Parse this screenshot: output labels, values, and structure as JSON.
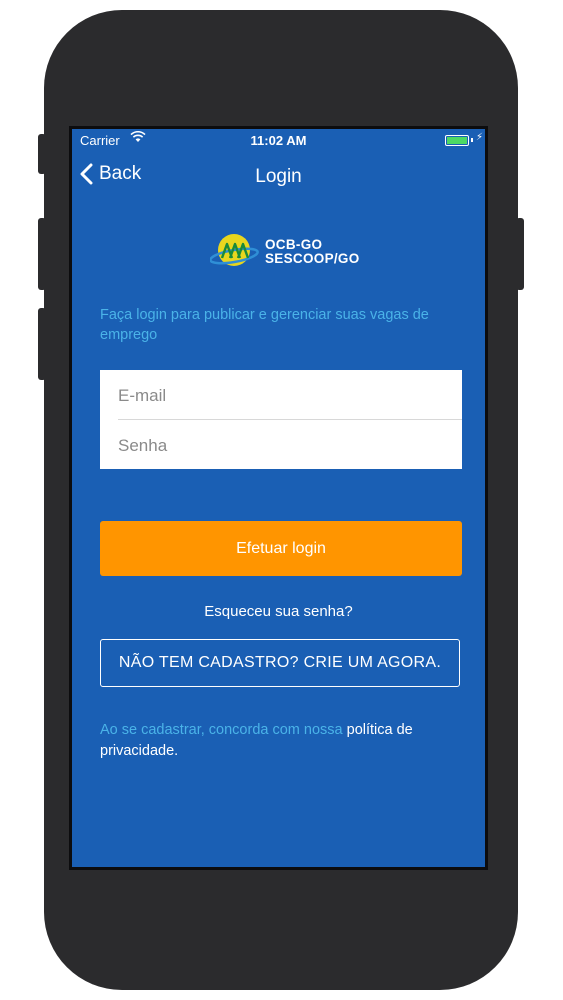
{
  "status_bar": {
    "carrier": "Carrier",
    "time": "11:02 AM",
    "battery_color": "#4cd964"
  },
  "nav": {
    "back_label": "Back",
    "title": "Login"
  },
  "logo": {
    "line1": "OCB-GO",
    "line2": "SESCOOP/GO"
  },
  "intro_text": "Faça login para publicar e gerenciar suas vagas de emprego",
  "form": {
    "email_placeholder": "E-mail",
    "password_placeholder": "Senha"
  },
  "login_button_label": "Efetuar login",
  "forgot_password_label": "Esqueceu sua senha?",
  "register_button_label": "NÃO TEM CADASTRO? CRIE UM AGORA.",
  "terms": {
    "prefix": "Ao se cadastrar, concorda com nossa ",
    "link": "política de privacidade",
    "suffix": "."
  },
  "colors": {
    "background": "#1a5fb4",
    "accent": "#ff9500",
    "info_text": "#4ab3e8"
  },
  "icons": {
    "back": "chevron-left-icon",
    "wifi": "wifi-icon",
    "battery": "battery-icon",
    "logo": "ocb-logo-icon"
  }
}
